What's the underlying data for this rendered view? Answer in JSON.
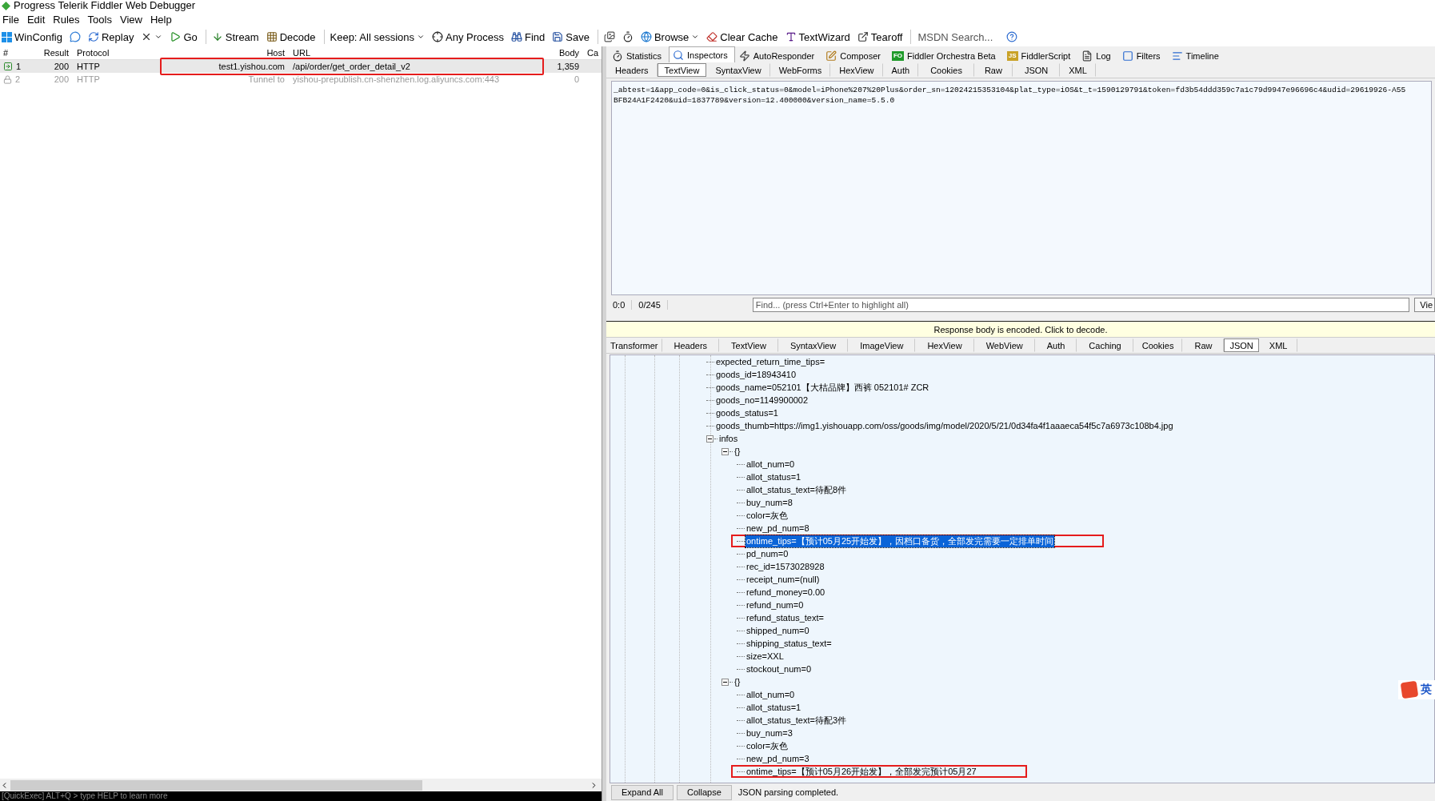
{
  "window": {
    "title": "Progress Telerik Fiddler Web Debugger"
  },
  "menu": [
    "File",
    "Edit",
    "Rules",
    "Tools",
    "View",
    "Help"
  ],
  "toolbar": [
    {
      "kind": "button",
      "label": "WinConfig"
    },
    {
      "kind": "icon"
    },
    {
      "kind": "button",
      "label": "Replay"
    },
    {
      "kind": "icon_dropdown"
    },
    {
      "kind": "button",
      "label": "Go"
    },
    {
      "kind": "button",
      "label": "Stream"
    },
    {
      "kind": "button",
      "label": "Decode"
    },
    {
      "kind": "dropdown",
      "label": "Keep: All sessions"
    },
    {
      "kind": "button",
      "label": "Any Process"
    },
    {
      "kind": "button",
      "label": "Find"
    },
    {
      "kind": "button",
      "label": "Save"
    },
    {
      "kind": "icon"
    },
    {
      "kind": "icon"
    },
    {
      "kind": "dropdown",
      "label": "Browse"
    },
    {
      "kind": "button",
      "label": "Clear Cache"
    },
    {
      "kind": "button",
      "label": "TextWizard"
    },
    {
      "kind": "button",
      "label": "Tearoff"
    },
    {
      "kind": "search",
      "placeholder": "MSDN Search..."
    },
    {
      "kind": "icon"
    }
  ],
  "sessions": {
    "columns": [
      "#",
      "Result",
      "Protocol",
      "Host",
      "URL",
      "Body",
      "Ca"
    ],
    "rows": [
      {
        "kind": "response",
        "id": "1",
        "result": "200",
        "protocol": "HTTP",
        "host": "test1.yishou.com",
        "url": "/api/order/get_order_detail_v2",
        "body": "1,359",
        "selected": true,
        "annotated": true
      },
      {
        "kind": "tunnel",
        "id": "2",
        "result": "200",
        "protocol": "HTTP",
        "host": "Tunnel to",
        "url": "yishou-prepublish.cn-shenzhen.log.aliyuncs.com:443",
        "body": "0",
        "selected": false,
        "annotated": false
      }
    ]
  },
  "quickexec": "[QuickExec] ALT+Q > type HELP to learn more",
  "tabs": [
    {
      "label": "Statistics",
      "selected": false
    },
    {
      "label": "Inspectors",
      "selected": true
    },
    {
      "label": "AutoResponder",
      "selected": false
    },
    {
      "label": "Composer",
      "selected": false
    },
    {
      "label": "Fiddler Orchestra Beta",
      "badge": "FO",
      "selected": false
    },
    {
      "label": "FiddlerScript",
      "badge": "JS",
      "selected": false
    },
    {
      "label": "Log",
      "selected": false
    },
    {
      "label": "Filters",
      "selected": false
    },
    {
      "label": "Timeline",
      "selected": false
    }
  ],
  "request": {
    "tabs": [
      {
        "label": "Headers",
        "selected": false
      },
      {
        "label": "TextView",
        "selected": true
      },
      {
        "label": "SyntaxView",
        "selected": false
      },
      {
        "label": "WebForms",
        "selected": false
      },
      {
        "label": "HexView",
        "selected": false
      },
      {
        "label": "Auth",
        "selected": false
      },
      {
        "label": "Cookies",
        "selected": false
      },
      {
        "label": "Raw",
        "selected": false
      },
      {
        "label": "JSON",
        "selected": false
      },
      {
        "label": "XML",
        "selected": false
      }
    ],
    "body_lines": [
      "_abtest=1&app_code=0&is_click_status=0&model=iPhone%207%20Plus&order_sn=12024215353104&plat_type=iOS&t_t=1590129791&token=fd3b54ddd359c7a1c79d9947e96696c4&udid=29619926-A55",
      "BFB24A1F2420&uid=1837789&version=12.400000&version_name=5.5.0"
    ],
    "position": "0:0",
    "count": "0/245",
    "find_placeholder": "Find... (press Ctrl+Enter to highlight all)",
    "view_button": "Vie"
  },
  "response": {
    "notice": "Response body is encoded. Click to decode.",
    "tabs": [
      {
        "label": "Transformer",
        "selected": false
      },
      {
        "label": "Headers",
        "selected": false
      },
      {
        "label": "TextView",
        "selected": false
      },
      {
        "label": "SyntaxView",
        "selected": false
      },
      {
        "label": "ImageView",
        "selected": false
      },
      {
        "label": "HexView",
        "selected": false
      },
      {
        "label": "WebView",
        "selected": false
      },
      {
        "label": "Auth",
        "selected": false
      },
      {
        "label": "Caching",
        "selected": false
      },
      {
        "label": "Cookies",
        "selected": false
      },
      {
        "label": "Raw",
        "selected": false
      },
      {
        "label": "JSON",
        "selected": true
      },
      {
        "label": "XML",
        "selected": false
      }
    ],
    "tree": [
      {
        "label": "expected_return_time_tips=",
        "selected": false,
        "annotated": false
      },
      {
        "label": "goods_id=18943410",
        "selected": false,
        "annotated": false
      },
      {
        "label": "goods_name=052101【大桔品牌】西裤 052101# ZCR",
        "selected": false,
        "annotated": false
      },
      {
        "label": "goods_no=1149900002",
        "selected": false,
        "annotated": false
      },
      {
        "label": "goods_status=1",
        "selected": false,
        "annotated": false
      },
      {
        "label": "goods_thumb=https://img1.yishouapp.com/oss/goods/img/model/2020/5/21/0d34fa4f1aaaeca54f5c7a6973c108b4.jpg",
        "selected": false,
        "annotated": false
      },
      {
        "label": "infos",
        "selected": false,
        "annotated": false,
        "expanded": true,
        "children": [
          {
            "label": "{}",
            "selected": false,
            "annotated": false,
            "expanded": true,
            "children": [
              {
                "label": "allot_num=0",
                "selected": false,
                "annotated": false
              },
              {
                "label": "allot_status=1",
                "selected": false,
                "annotated": false
              },
              {
                "label": "allot_status_text=待配8件",
                "selected": false,
                "annotated": false
              },
              {
                "label": "buy_num=8",
                "selected": false,
                "annotated": false
              },
              {
                "label": "color=灰色",
                "selected": false,
                "annotated": false
              },
              {
                "label": "new_pd_num=8",
                "selected": false,
                "annotated": false
              },
              {
                "label": "ontime_tips=【预计05月25开始发】，因档口备货，全部发完需要一定排单时间",
                "selected": true,
                "annotated": true
              },
              {
                "label": "pd_num=0",
                "selected": false,
                "annotated": false
              },
              {
                "label": "rec_id=1573028928",
                "selected": false,
                "annotated": false
              },
              {
                "label": "receipt_num=(null)",
                "selected": false,
                "annotated": false
              },
              {
                "label": "refund_money=0.00",
                "selected": false,
                "annotated": false
              },
              {
                "label": "refund_num=0",
                "selected": false,
                "annotated": false
              },
              {
                "label": "refund_status_text=",
                "selected": false,
                "annotated": false
              },
              {
                "label": "shipped_num=0",
                "selected": false,
                "annotated": false
              },
              {
                "label": "shipping_status_text=",
                "selected": false,
                "annotated": false
              },
              {
                "label": "size=XXL",
                "selected": false,
                "annotated": false
              },
              {
                "label": "stockout_num=0",
                "selected": false,
                "annotated": false
              }
            ]
          },
          {
            "label": "{}",
            "selected": false,
            "annotated": false,
            "expanded": true,
            "children": [
              {
                "label": "allot_num=0",
                "selected": false,
                "annotated": false
              },
              {
                "label": "allot_status=1",
                "selected": false,
                "annotated": false
              },
              {
                "label": "allot_status_text=待配3件",
                "selected": false,
                "annotated": false
              },
              {
                "label": "buy_num=3",
                "selected": false,
                "annotated": false
              },
              {
                "label": "color=灰色",
                "selected": false,
                "annotated": false
              },
              {
                "label": "new_pd_num=3",
                "selected": false,
                "annotated": false
              },
              {
                "label": "ontime_tips=【预计05月26开始发】，全部发完预计05月27",
                "selected": false,
                "annotated": true
              }
            ]
          }
        ]
      }
    ],
    "buttons": [
      "Expand All",
      "Collapse"
    ],
    "status": "JSON parsing completed."
  },
  "ime": {
    "label": "英"
  }
}
